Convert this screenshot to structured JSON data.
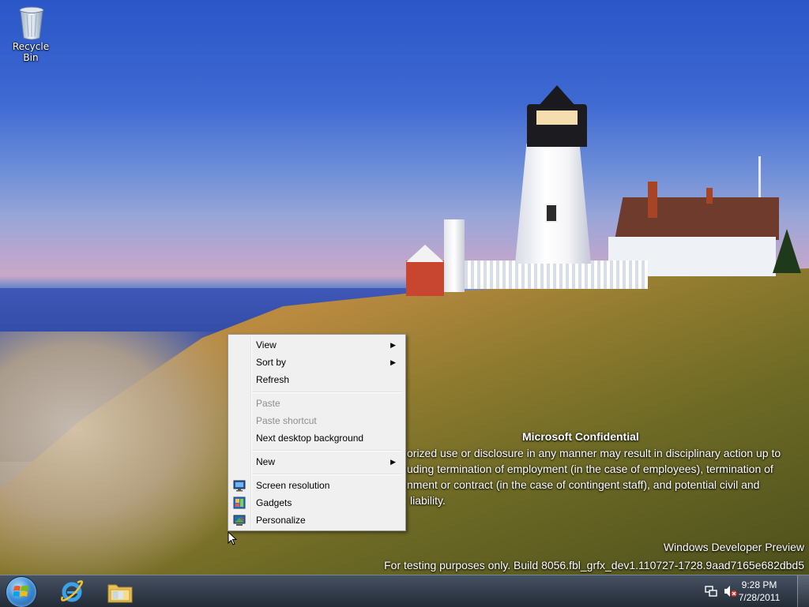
{
  "desktop": {
    "icons": [
      {
        "label": "Recycle Bin",
        "icon": "recycle-bin-icon"
      }
    ]
  },
  "context_menu": {
    "items": [
      {
        "label": "View",
        "submenu": true,
        "enabled": true
      },
      {
        "label": "Sort by",
        "submenu": true,
        "enabled": true
      },
      {
        "label": "Refresh",
        "submenu": false,
        "enabled": true
      },
      {
        "label": "Paste",
        "submenu": false,
        "enabled": false
      },
      {
        "label": "Paste shortcut",
        "submenu": false,
        "enabled": false
      },
      {
        "label": "Next desktop background",
        "submenu": false,
        "enabled": true
      },
      {
        "label": "New",
        "submenu": true,
        "enabled": true
      },
      {
        "label": "Screen resolution",
        "icon": "display-icon",
        "enabled": true
      },
      {
        "label": "Gadgets",
        "icon": "gadgets-icon",
        "enabled": true
      },
      {
        "label": "Personalize",
        "icon": "personalize-icon",
        "enabled": true
      }
    ],
    "submenu_arrow": "▶"
  },
  "watermark": {
    "title": "Microsoft Confidential",
    "lines": [
      "orized use or disclosure in any manner may result in disciplinary action up to",
      "uding termination of employment (in the case of employees), termination of",
      "nment or contract (in the case of contingent staff), and potential civil and",
      "liability."
    ],
    "product": "Windows Developer Preview",
    "build": "For testing purposes only. Build 8056.fbl_grfx_dev1.110727-1728.9aad7165e682dbd5"
  },
  "taskbar": {
    "start_icon": "windows-start-icon",
    "pinned": [
      {
        "name": "internet-explorer",
        "icon": "ie-icon"
      },
      {
        "name": "windows-explorer",
        "icon": "folder-icon"
      }
    ],
    "tray": {
      "icons": [
        "network-icon",
        "volume-muted-icon"
      ],
      "time": "9:28 PM",
      "date": "7/28/2011"
    }
  }
}
